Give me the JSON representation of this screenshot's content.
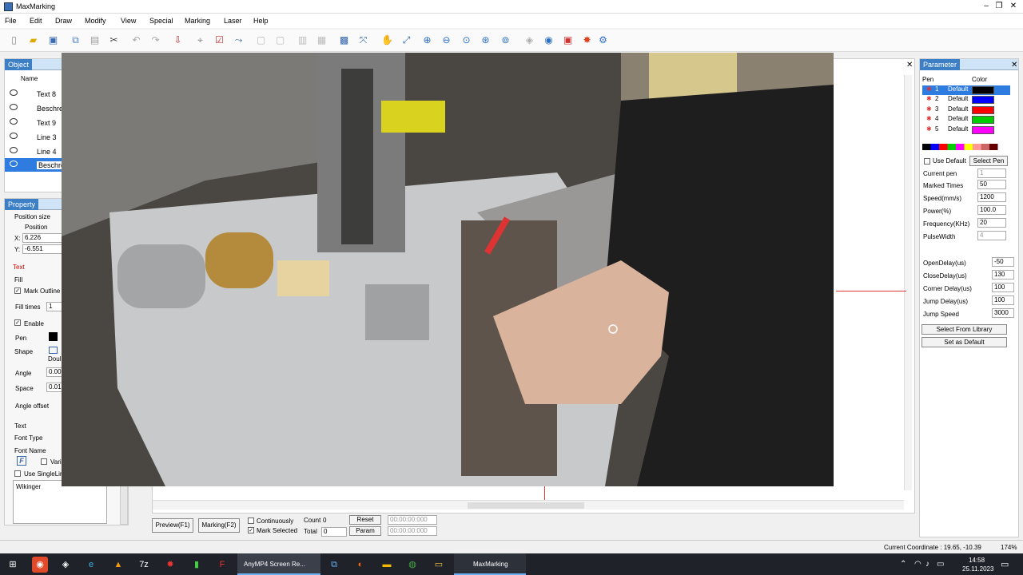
{
  "app": {
    "title": "MaxMarking"
  },
  "menu": [
    "File",
    "Edit",
    "Draw",
    "Modify",
    "View",
    "Special",
    "Marking",
    "Laser",
    "Help"
  ],
  "object_panel": {
    "title": "Object",
    "header_name": "Name",
    "rows": [
      "Text 8",
      "Beschrei",
      "Text 9",
      "Line 3",
      "Line 4",
      "Beschrei"
    ]
  },
  "property_panel": {
    "title": "Property",
    "position_size": "Position size",
    "position": "Position",
    "x_label": "X:",
    "x_value": "6.226",
    "y_label": "Y:",
    "y_value": "-6.551",
    "text_section": "Text",
    "fill": "Fill",
    "mark_outline": "Mark Outline",
    "fill_times_label": "Fill times",
    "fill_times_value": "1",
    "enable": "Enable",
    "pen": "Pen",
    "shape": "Shape",
    "shape_value": "Doul",
    "angle": "Angle",
    "angle_value": "0.00",
    "space": "Space",
    "space_value": "0.010",
    "angle_offset": "Angle offset",
    "text_label": "Text",
    "font_type": "Font Type",
    "font_name": "Font Name",
    "font_icon": "F",
    "variable": "Varia",
    "use_singleline": "Use SingleLin",
    "text_content": "Wikinger"
  },
  "param_panel": {
    "title": "Parameter",
    "pen_header": "Pen",
    "color_header": "Color",
    "pens": [
      {
        "num": "1",
        "name": "Default",
        "color": "#000000"
      },
      {
        "num": "2",
        "name": "Default",
        "color": "#0000ff"
      },
      {
        "num": "3",
        "name": "Default",
        "color": "#ff0000"
      },
      {
        "num": "4",
        "name": "Default",
        "color": "#00cc00"
      },
      {
        "num": "5",
        "name": "Default",
        "color": "#ff00ff"
      }
    ],
    "use_default": "Use Default",
    "select_pen": "Select Pen",
    "current_pen": "Current pen",
    "current_pen_value": "1",
    "fields": [
      {
        "label": "Marked Times",
        "value": "50"
      },
      {
        "label": "Speed(mm/s)",
        "value": "1200"
      },
      {
        "label": "Power(%)",
        "value": "100.0"
      },
      {
        "label": "Frequency(KHz)",
        "value": "20"
      },
      {
        "label": "PulseWidth",
        "value": "4"
      }
    ],
    "delays": [
      {
        "label": "OpenDelay(us)",
        "value": "-50"
      },
      {
        "label": "CloseDelay(us)",
        "value": "130"
      },
      {
        "label": "Corner Delay(us)",
        "value": "100"
      },
      {
        "label": "Jump Delay(us)",
        "value": "100"
      },
      {
        "label": "Jump Speed",
        "value": "3000"
      }
    ],
    "select_from_library": "Select From Library",
    "set_as_default": "Set as Default"
  },
  "bottom": {
    "preview": "Preview(F1)",
    "marking": "Marking(F2)",
    "continuously": "Continuously",
    "mark_selected": "Mark Selected",
    "count_label": "Count",
    "count_value": "0",
    "total_label": "Total",
    "total_value": "0",
    "reset": "Reset",
    "param": "Param",
    "time1": "00:00:00:000",
    "time2": "00:00:00:000"
  },
  "status": {
    "coordinate": "Current Coordinate : 19.65,    -10.39",
    "zoom": "174%"
  },
  "taskbar": {
    "recorder": "AnyMP4 Screen Re...",
    "maxmarking": "MaxMarking",
    "time": "14:58",
    "date": "25.11.2023"
  },
  "colors": {
    "panel_header": "#3d7fc5",
    "selected_row": "#2f7ce0",
    "taskbar": "#1f2229"
  }
}
